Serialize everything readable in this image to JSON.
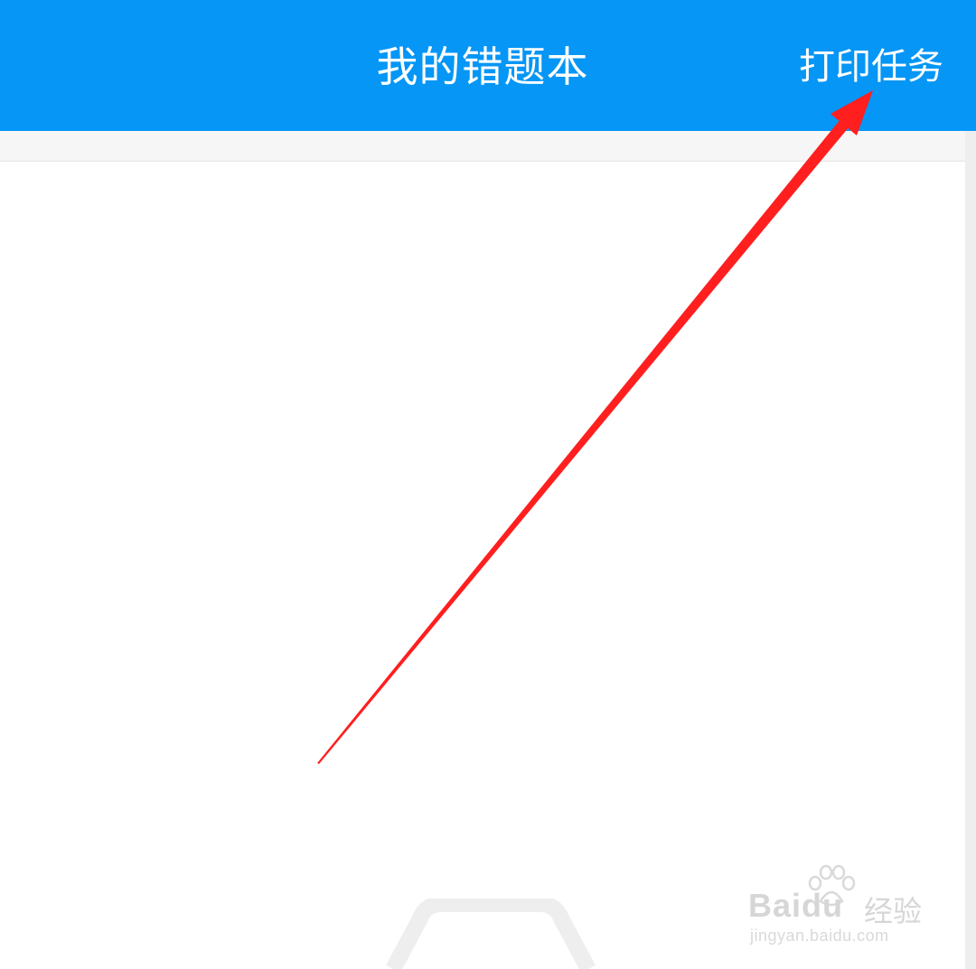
{
  "header": {
    "title": "我的错题本",
    "right_action_label": "打印任务"
  },
  "colors": {
    "header_bg": "#0596f6",
    "annotation_arrow": "#ff1f1f"
  },
  "empty_state": {
    "icon": "tray-icon"
  },
  "watermark": {
    "brand": "Baidu",
    "product": "经验",
    "url": "jingyan.baidu.com"
  }
}
